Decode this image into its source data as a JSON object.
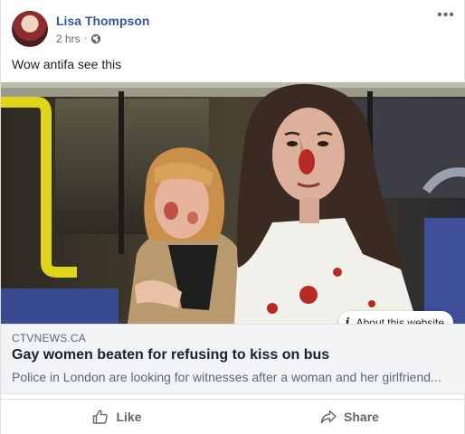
{
  "post": {
    "author": "Lisa Thompson",
    "timestamp": "2 hrs",
    "separator": "·",
    "privacy_icon": "globe-icon",
    "more_icon": "more-options-icon",
    "more_label": "•••",
    "message": "Wow antifa see this"
  },
  "link_card": {
    "domain": "CTVNEWS.CA",
    "headline": "Gay women beaten for refusing to kiss on bus",
    "snippet": "Police in London are looking for witnesses after a woman and her girlfriend...",
    "about_label": "About this website",
    "about_icon": "info-icon",
    "about_icon_glyph": "i"
  },
  "actions": {
    "like_label": "Like",
    "like_icon": "thumbs-up-icon",
    "share_label": "Share",
    "share_icon": "share-arrow-icon"
  },
  "colors": {
    "author_link": "#385898",
    "secondary_text": "#606770",
    "card_background": "#f2f3f5",
    "border": "#dddfe2"
  }
}
